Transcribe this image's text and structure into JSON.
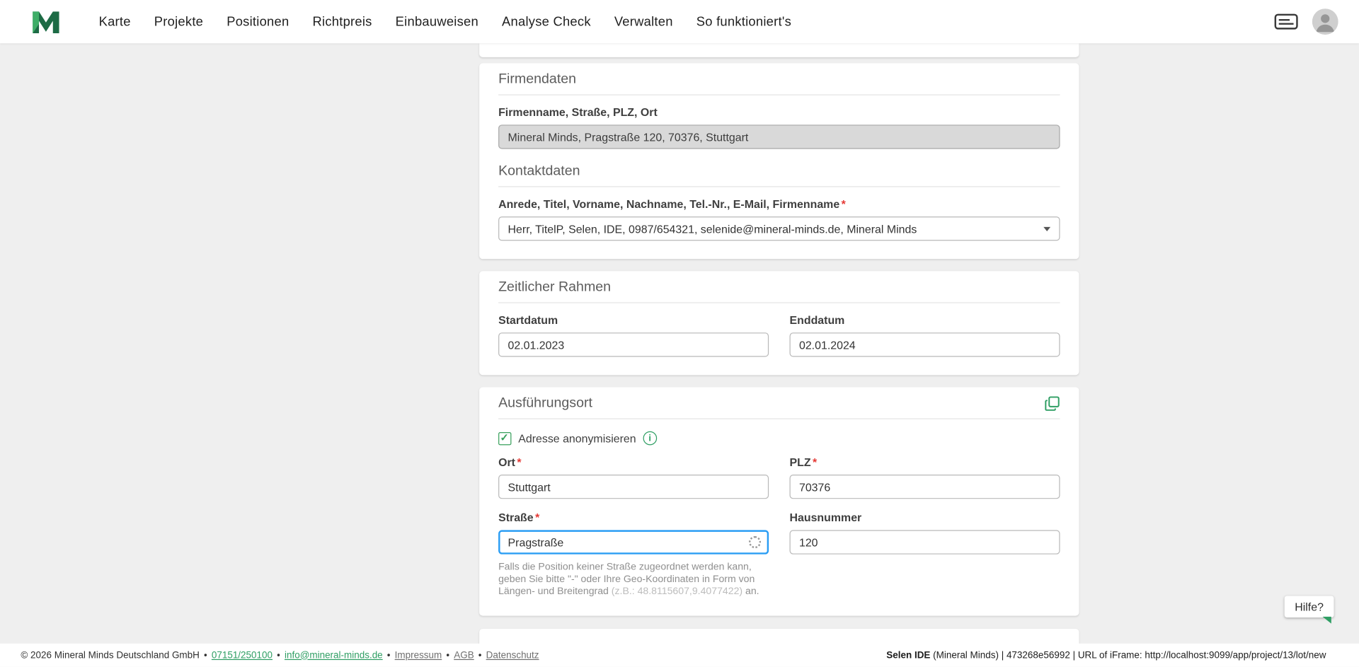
{
  "ui": {
    "required_marker": "*"
  },
  "colors": {
    "brand_green": "#2e9e63",
    "checkbox_green": "#38a05c",
    "focus_blue": "#2a9df4",
    "required_red": "#e53935"
  },
  "nav": {
    "items": [
      "Karte",
      "Projekte",
      "Positionen",
      "Richtpreis",
      "Einbauweisen",
      "Analyse Check",
      "Verwalten",
      "So funktioniert's"
    ]
  },
  "firmendaten": {
    "title": "Firmendaten",
    "company_label": "Firmenname, Straße, PLZ, Ort",
    "company_value": "Mineral Minds, Pragstraße 120, 70376, Stuttgart",
    "kontakt_title": "Kontaktdaten",
    "kontakt_label": "Anrede, Titel, Vorname, Nachname, Tel.-Nr., E-Mail, Firmenname",
    "kontakt_value": "Herr, TitelP, Selen, IDE, 0987/654321, selenide@mineral-minds.de, Mineral Minds"
  },
  "zeitraum": {
    "title": "Zeitlicher Rahmen",
    "start_label": "Startdatum",
    "start_value": "02.01.2023",
    "end_label": "Enddatum",
    "end_value": "02.01.2024"
  },
  "ort": {
    "title": "Ausführungsort",
    "anonymize_label": "Adresse anonymisieren",
    "ort_label": "Ort",
    "ort_value": "Stuttgart",
    "plz_label": "PLZ",
    "plz_value": "70376",
    "strasse_label": "Straße",
    "strasse_value": "Pragstraße",
    "hausnummer_label": "Hausnummer",
    "hausnummer_value": "120",
    "helper_prefix": "Falls die Position keiner Straße zugeordnet werden kann, geben Sie bitte \"-\" oder Ihre Geo-Koordinaten in Form von Längen- und Breitengrad ",
    "helper_example": "(z.B.: 48.8115607,9.4077422)",
    "helper_suffix": " an."
  },
  "help": {
    "label": "Hilfe?"
  },
  "footer": {
    "sep": "•",
    "copyright": "© 2026 Mineral Minds Deutschland GmbH",
    "phone": "07151/250100",
    "email": "info@mineral-minds.de",
    "impressum": "Impressum",
    "agb": "AGB",
    "datenschutz": "Datenschutz",
    "right_bold": "Selen IDE",
    "right_rest": " (Mineral Minds) | 473268e56992 | URL of iFrame: http://localhost:9099/app/project/13/lot/new"
  }
}
